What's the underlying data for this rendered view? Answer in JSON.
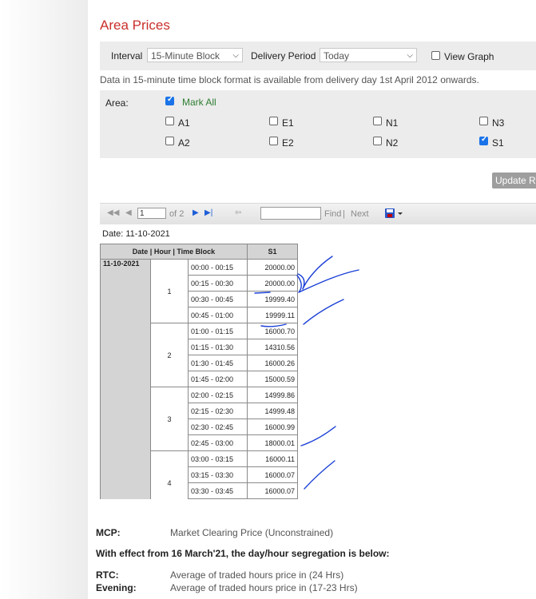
{
  "page": {
    "title": "Area Prices",
    "interval_label": "Interval",
    "interval_value": "15-Minute Block",
    "delivery_label": "Delivery Period",
    "delivery_value": "Today",
    "view_graph_label": "View Graph",
    "note": "Data in 15-minute time block format is available from delivery day 1st April 2012 onwards."
  },
  "area": {
    "label": "Area:",
    "mark_all": "Mark All",
    "options": [
      {
        "name": "A1",
        "checked": false
      },
      {
        "name": "E1",
        "checked": false
      },
      {
        "name": "N1",
        "checked": false
      },
      {
        "name": "N3",
        "checked": false
      },
      {
        "name": "A2",
        "checked": false
      },
      {
        "name": "E2",
        "checked": false
      },
      {
        "name": "N2",
        "checked": false
      },
      {
        "name": "S1",
        "checked": true
      }
    ]
  },
  "update_button": "Update R",
  "toolbar": {
    "page_value": "1",
    "of_pages": "of 2",
    "find_label": "Find",
    "separator": "|",
    "next_label": "Next"
  },
  "report": {
    "date_line": "Date: 11-10-2021",
    "header_1": "Date | Hour | Time Block",
    "header_2": "S1",
    "date": "11-10-2021",
    "hours": [
      {
        "hour": "1",
        "blocks": [
          {
            "time": "00:00 - 00:15",
            "value": "20000.00"
          },
          {
            "time": "00:15 - 00:30",
            "value": "20000.00"
          },
          {
            "time": "00:30 - 00:45",
            "value": "19999.40"
          },
          {
            "time": "00:45 - 01:00",
            "value": "19999.11"
          }
        ]
      },
      {
        "hour": "2",
        "blocks": [
          {
            "time": "01:00 - 01:15",
            "value": "16000.70"
          },
          {
            "time": "01:15 - 01:30",
            "value": "14310.56"
          },
          {
            "time": "01:30 - 01:45",
            "value": "16000.26"
          },
          {
            "time": "01:45 - 02:00",
            "value": "15000.59"
          }
        ]
      },
      {
        "hour": "3",
        "blocks": [
          {
            "time": "02:00 - 02:15",
            "value": "14999.86"
          },
          {
            "time": "02:15 - 02:30",
            "value": "14999.48"
          },
          {
            "time": "02:30 - 02:45",
            "value": "16000.99"
          },
          {
            "time": "02:45 - 03:00",
            "value": "18000.01"
          }
        ]
      },
      {
        "hour": "4",
        "blocks": [
          {
            "time": "03:00 - 03:15",
            "value": "16000.11"
          },
          {
            "time": "03:15 - 03:30",
            "value": "16000.07"
          },
          {
            "time": "03:30 - 03:45",
            "value": "16000.07"
          },
          {
            "time": "",
            "value": ""
          }
        ]
      }
    ]
  },
  "legend": {
    "mcp_term": "MCP:",
    "mcp_desc": "Market Clearing Price (Unconstrained)",
    "effect_heading": "With effect from 16 March'21, the day/hour segregation is below:",
    "rtc_term": "RTC:",
    "rtc_desc": "Average of traded hours price in (24 Hrs)",
    "evening_term": "Evening:",
    "evening_desc": "Average of traded hours price in (17-23 Hrs)"
  },
  "colors": {
    "title": "#c9302c",
    "mark_all": "#2e7d32",
    "checkbox_checked": "#1a73e8",
    "ink": "#1a3fd6"
  }
}
